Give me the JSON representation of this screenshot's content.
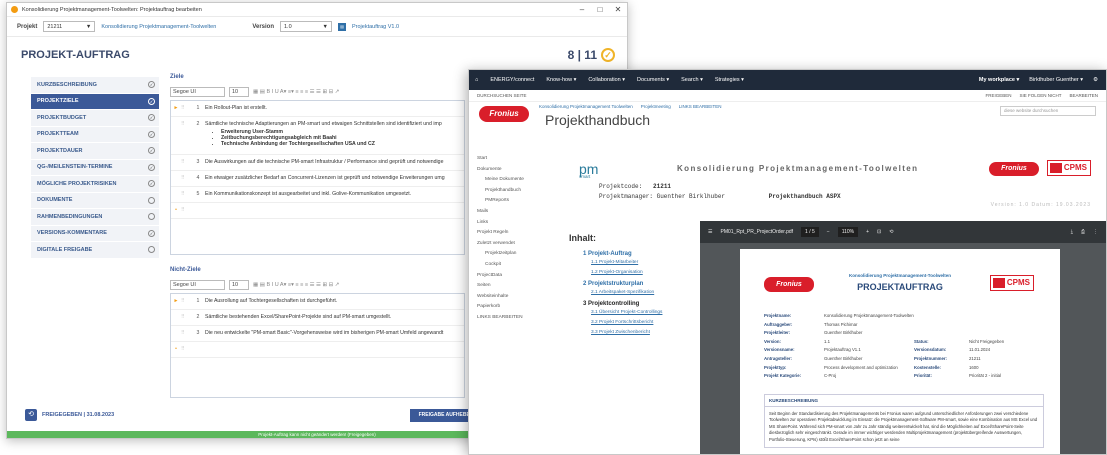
{
  "win1": {
    "title": "Konsolidierung Projektmanagement-Toolwelten: Projektauftrag bearbeiten",
    "controls": [
      "–",
      "□",
      "✕"
    ],
    "toolbar": {
      "projekt_label": "Projekt",
      "projekt_value": "21211",
      "projekt_link": "Konsolidierung Projektmanagement-Toolwelten",
      "version_label": "Version",
      "version_value": "1.0",
      "version_link": "Projektauftrag V1.0"
    },
    "page_title": "PROJEKT-AUFTRAG",
    "counter": "8 | 11",
    "sidebar": [
      {
        "label": "KURZBESCHREIBUNG",
        "status": "✓"
      },
      {
        "label": "PROJEKTZIELE",
        "status": "✓"
      },
      {
        "label": "PROJEKTBUDGET",
        "status": "✓"
      },
      {
        "label": "PROJEKTTEAM",
        "status": "✓"
      },
      {
        "label": "PROJEKTDAUER",
        "status": "✓"
      },
      {
        "label": "QG-/MEILENSTEIN-TERMINE",
        "status": "✓"
      },
      {
        "label": "MÖGLICHE PROJEKTRISIKEN",
        "status": "✓"
      },
      {
        "label": "DOKUMENTE",
        "status": ""
      },
      {
        "label": "RAHMENBEDINGUNGEN",
        "status": ""
      },
      {
        "label": "VERSIONS-KOMMENTARE",
        "status": "✓"
      },
      {
        "label": "DIGITALE FREIGABE",
        "status": ""
      }
    ],
    "ziele": {
      "label": "Ziele",
      "font": "Segoe UI",
      "size": "10",
      "rows": [
        {
          "num": "1",
          "text": "Ein Rollout-Plan ist erstellt."
        },
        {
          "num": "2",
          "text": "Sämtliche technische Adaptierungen an PM-smart und etwaigen Schnittstellen sind identifiziert und imp",
          "bullets": [
            "Erweiterung User-Stamm",
            "Zeitbuchungsberechtigungsabgleich mit Baahi",
            "Technische Anbindung der Tochtergesellschaften USA und CZ"
          ]
        },
        {
          "num": "3",
          "text": "Die Auswirkungen auf die technische PM-smart Infrastruktur / Performance sind geprüft und notwendige"
        },
        {
          "num": "4",
          "text": "Ein etwaiger zusätzlicher Bedarf an Concurrent-Lizenzen ist geprüft und notwendige Erweiterungen umg"
        },
        {
          "num": "5",
          "text": "Ein Kommunikationskonzept ist ausgearbeitet und inkl. Golive-Kommunikation umgesetzt."
        }
      ]
    },
    "nicht_ziele": {
      "label": "Nicht-Ziele",
      "font": "Segoe UI",
      "size": "10",
      "rows": [
        {
          "num": "1",
          "text": "Die Ausrollung auf Tochtergesellschaften ist durchgeführt."
        },
        {
          "num": "2",
          "text": "Sämtliche bestehenden Excel/SharePoint-Projekte sind auf PM-smart umgestellt."
        },
        {
          "num": "3",
          "text": "Die neu entwickelte \"PM-smart Basic\"-Vorgehensweise wird im bisherigen PM-smart Umfeld angewandt"
        }
      ]
    },
    "footer": {
      "status": "FREIGEGEBEN | 31.08.2023",
      "button": "FREIGABE AUFHEBEN",
      "green_bar": "Projekt-Auftrag kann nicht geändert werden! (Freigegeben)"
    }
  },
  "win2": {
    "nav": {
      "brand": "ENERGY/connect",
      "items": [
        "Know-how ▾",
        "Collaboration ▾",
        "Documents ▾",
        "Search ▾",
        "Strategies ▾"
      ],
      "workplace": "My workplace ▾",
      "user": "Birkthuber Guenther ▾"
    },
    "subnav": {
      "left": "DURCHSUCHEN   SEITE",
      "right": [
        "FREIGEBEN",
        "SIE FOLGEN NICHT",
        "BEARBEITEN"
      ]
    },
    "brand_links": [
      "Konsolidierung Projektmanagement Toolwelten",
      "Projektmeeting",
      "LINKS BEARBEITEN"
    ],
    "brand_title": "Projekthandbuch",
    "search_placeholder": "diese website durchsuchen",
    "leftnav": [
      "Start",
      "Dokumente",
      "Meine Dokumente",
      "Projekthandbuch",
      "PMReports",
      "Mails",
      "Links",
      "Projekt Regeln",
      "Zuletzt verwendet",
      "Projektzeitplan",
      "Cockpit",
      "ProjectData",
      "Seiten",
      "Websiteinhalte",
      "Papierkorb",
      "LINKS BEARBEITEN"
    ],
    "doc": {
      "title": "Konsolidierung Projektmanagement-Toolwelten",
      "projektcode_label": "Projektcode:",
      "projektcode_value": "21211",
      "manager_label": "Projektmanager: Guenther Birklhuber",
      "handbuch": "Projekthandbuch ASPX",
      "version": "Version: 1.0 Datum: 19.03.2023"
    },
    "toc": {
      "title": "Inhalt:",
      "h1": [
        "1 Projekt-Auftrag",
        "2 Projektstrukturplan",
        "3 Projektcontrolling"
      ],
      "h2_1": [
        "1.1 Projekt-Mitarbeiter",
        "1.2 Projekt-Organisation"
      ],
      "h2_2": [
        "2.1 Arbeitspaket-Spezifikation"
      ],
      "h2_3": [
        "3.1 Übersicht Projekt-Controllings",
        "3.2 Projekt Fortschrittsbericht",
        "3.3 Projekt Zwischenbericht"
      ]
    },
    "pdf": {
      "filename": "PM01_Rpt_PR_ProjectOrder.pdf",
      "page": "1 / 5",
      "zoom": "110%",
      "subtitle": "Konsolidierung Projektmanagement-Toolwelten",
      "title": "PROJEKTAUFTRAG",
      "rows": [
        {
          "k": "Projektname:",
          "v": "Konsolidierung Projektmanagement-Toolwelten",
          "k2": "",
          "v2": ""
        },
        {
          "k": "Auftraggeber:",
          "v": "Thomas Pichimar",
          "k2": "",
          "v2": ""
        },
        {
          "k": "Projektleiter:",
          "v": "Guenther Birklhuber",
          "k2": "",
          "v2": ""
        },
        {
          "k": "Version:",
          "v": "1.1",
          "k2": "Status:",
          "v2": "Nicht Freigegeben"
        },
        {
          "k": "Versionsname:",
          "v": "Projektauftrag V1.1",
          "k2": "Versionsdatum:",
          "v2": "11.01.2024"
        },
        {
          "k": "Antragsteller:",
          "v": "Guenther Birklhuber",
          "k2": "Projektnummer:",
          "v2": "21211"
        },
        {
          "k": "Projekttyp:",
          "v": "Process development and optimization",
          "k2": "Kostenstelle:",
          "v2": "1600"
        },
        {
          "k": "Projekt Kategorie:",
          "v": "C-Proj",
          "k2": "Priorität:",
          "v2": "Priorität 2 - initial"
        }
      ],
      "section_head": "KURZBESCHREIBUNG",
      "section_body": "Seit Beginn der Standardisierung des Projektmanagements bei Fronius waren aufgrund unterschiedlicher Anforderungen zwei verschiedene Toolwelten zur operativen Projektabwicklung im Einsatz: die Projektmanagement-Software PM-smart, sowie eine Kombination aus MS Excel und MS SharePoint. Während sich PM-smart von Jahr zu Jahr ständig weiterentwickelt hat, sind die Möglichkeiten auf Excel/SharePoint-Seite diesbezüglich sehr eingeschränkt. Gerade im immer wichtiger werdenden Multiprojektmanagement (projektübergreifende Auswertungen, Portfolio-Steuerung, KPIs) stößt Excel/SharePoint schon jetzt an seine"
    }
  }
}
